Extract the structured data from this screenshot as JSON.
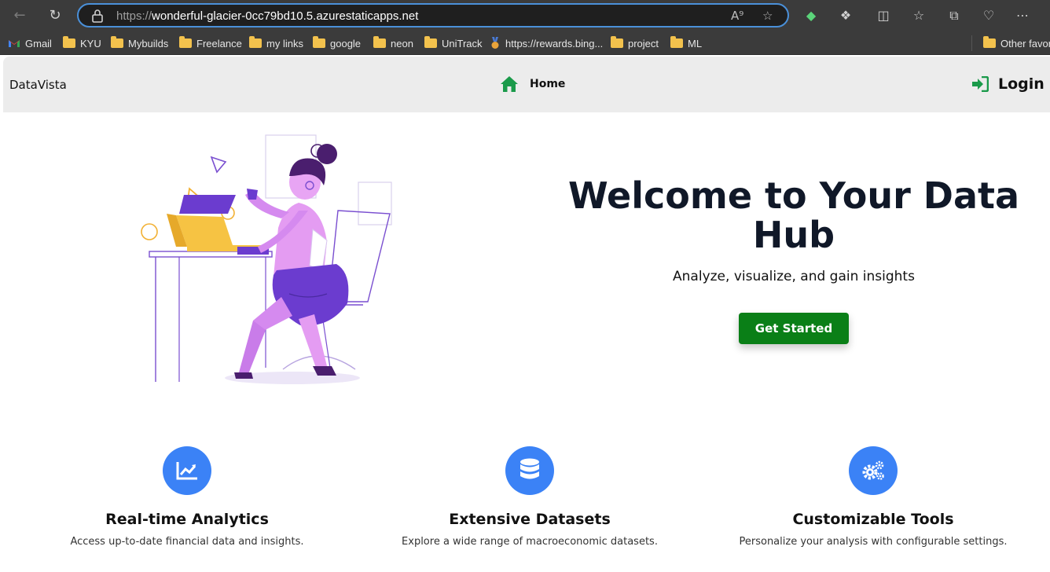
{
  "browser": {
    "url_scheme": "https://",
    "url_host": "wonderful-glacier-0cc79bd10.5.azurestaticapps.net",
    "bookmarks": [
      {
        "label": "Gmail",
        "icon": "gmail-icon"
      },
      {
        "label": "KYU",
        "icon": "folder-icon"
      },
      {
        "label": "Mybuilds",
        "icon": "folder-icon"
      },
      {
        "label": "Freelance",
        "icon": "folder-icon"
      },
      {
        "label": "my links",
        "icon": "folder-icon"
      },
      {
        "label": "google",
        "icon": "folder-icon"
      },
      {
        "label": "neon",
        "icon": "folder-icon"
      },
      {
        "label": "UniTrack",
        "icon": "folder-icon"
      },
      {
        "label": "https://rewards.bing...",
        "icon": "medal-icon"
      },
      {
        "label": "project",
        "icon": "folder-icon"
      },
      {
        "label": "ML",
        "icon": "folder-icon"
      }
    ],
    "other_favorites": "Other favori"
  },
  "site": {
    "brand": "DataVista",
    "nav": {
      "home_label": "Home",
      "login_label": "Login"
    },
    "hero": {
      "title": "Welcome to Your Data Hub",
      "subtitle": "Analyze, visualize, and gain insights",
      "cta_label": "Get Started"
    },
    "features": [
      {
        "title": "Real-time Analytics",
        "desc": "Access up-to-date financial data and insights.",
        "icon": "chart-line-icon"
      },
      {
        "title": "Extensive Datasets",
        "desc": "Explore a wide range of macroeconomic datasets.",
        "icon": "database-icon"
      },
      {
        "title": "Customizable Tools",
        "desc": "Personalize your analysis with configurable settings.",
        "icon": "gears-icon"
      }
    ]
  },
  "colors": {
    "accent_green": "#0a7f17",
    "icon_green": "#1a9a4a",
    "feature_blue": "#3b82f6",
    "header_bg": "#ececec"
  }
}
